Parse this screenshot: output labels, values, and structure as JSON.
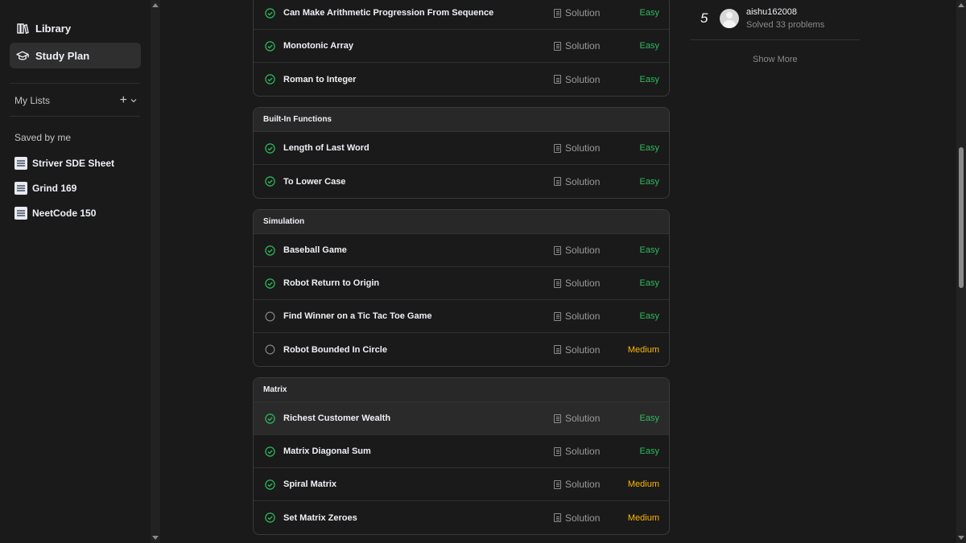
{
  "sidebar": {
    "nav": [
      {
        "label": "Library",
        "icon": "books-icon"
      },
      {
        "label": "Study Plan",
        "icon": "graduation-cap-icon"
      }
    ],
    "my_lists_label": "My Lists",
    "saved_label": "Saved by me",
    "lists": [
      {
        "label": "Striver SDE Sheet"
      },
      {
        "label": "Grind 169"
      },
      {
        "label": "NeetCode 150"
      }
    ]
  },
  "main": {
    "solution_label": "Solution",
    "top_rows": [
      {
        "title": "Can Make Arithmetic Progression From Sequence",
        "solved": true,
        "difficulty": "Easy"
      },
      {
        "title": "Monotonic Array",
        "solved": true,
        "difficulty": "Easy"
      },
      {
        "title": "Roman to Integer",
        "solved": true,
        "difficulty": "Easy"
      }
    ],
    "groups": [
      {
        "name": "Built-In Functions",
        "rows": [
          {
            "title": "Length of Last Word",
            "solved": true,
            "difficulty": "Easy"
          },
          {
            "title": "To Lower Case",
            "solved": true,
            "difficulty": "Easy"
          }
        ]
      },
      {
        "name": "Simulation",
        "rows": [
          {
            "title": "Baseball Game",
            "solved": true,
            "difficulty": "Easy"
          },
          {
            "title": "Robot Return to Origin",
            "solved": true,
            "difficulty": "Easy"
          },
          {
            "title": "Find Winner on a Tic Tac Toe Game",
            "solved": false,
            "difficulty": "Easy"
          },
          {
            "title": "Robot Bounded In Circle",
            "solved": false,
            "difficulty": "Medium"
          }
        ]
      },
      {
        "name": "Matrix",
        "rows": [
          {
            "title": "Richest Customer Wealth",
            "solved": true,
            "difficulty": "Easy"
          },
          {
            "title": "Matrix Diagonal Sum",
            "solved": true,
            "difficulty": "Easy"
          },
          {
            "title": "Spiral Matrix",
            "solved": true,
            "difficulty": "Medium"
          },
          {
            "title": "Set Matrix Zeroes",
            "solved": true,
            "difficulty": "Medium"
          }
        ]
      }
    ]
  },
  "leaderboard": {
    "rank": "5",
    "username": "aishu162008",
    "solved_text": "Solved 33 problems",
    "show_more": "Show More"
  },
  "colors": {
    "easy": "#2cbb5d",
    "medium": "#ffb800",
    "check": "#2cbb5d"
  }
}
